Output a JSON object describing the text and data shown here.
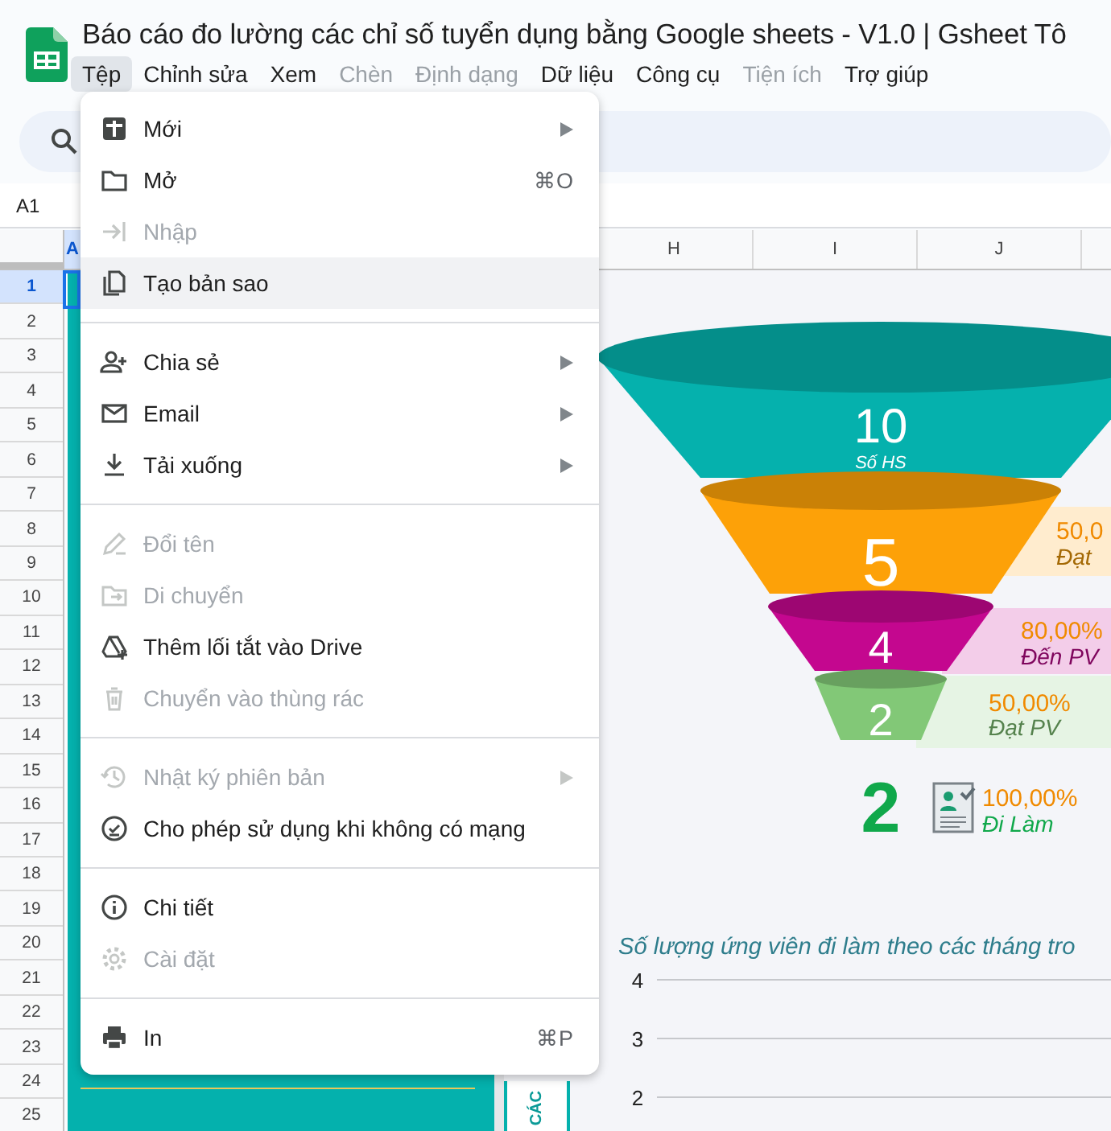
{
  "app": {
    "title": "Báo cáo đo lường các chỉ số tuyển dụng bằng Google sheets - V1.0 | Gsheet Tô"
  },
  "menubar": [
    {
      "label": "Tệp",
      "selected": true,
      "disabled": false
    },
    {
      "label": "Chỉnh sửa",
      "selected": false,
      "disabled": false
    },
    {
      "label": "Xem",
      "selected": false,
      "disabled": false
    },
    {
      "label": "Chèn",
      "selected": false,
      "disabled": true
    },
    {
      "label": "Định dạng",
      "selected": false,
      "disabled": true
    },
    {
      "label": "Dữ liệu",
      "selected": false,
      "disabled": false
    },
    {
      "label": "Công cụ",
      "selected": false,
      "disabled": false
    },
    {
      "label": "Tiện ích",
      "selected": false,
      "disabled": true
    },
    {
      "label": "Trợ giúp",
      "selected": false,
      "disabled": false
    }
  ],
  "name_box": "A1",
  "column_headers": [
    {
      "label": "A",
      "selected": true
    },
    {
      "label": "H",
      "selected": false
    },
    {
      "label": "I",
      "selected": false
    },
    {
      "label": "J",
      "selected": false
    }
  ],
  "row_headers": [
    {
      "label": "1",
      "selected": true
    },
    {
      "label": "2",
      "selected": false
    },
    {
      "label": "3",
      "selected": false
    },
    {
      "label": "4",
      "selected": false
    },
    {
      "label": "5",
      "selected": false
    },
    {
      "label": "6",
      "selected": false
    },
    {
      "label": "7",
      "selected": false
    },
    {
      "label": "8",
      "selected": false
    },
    {
      "label": "9",
      "selected": false
    },
    {
      "label": "10",
      "selected": false
    },
    {
      "label": "11",
      "selected": false
    },
    {
      "label": "12",
      "selected": false
    },
    {
      "label": "13",
      "selected": false
    },
    {
      "label": "14",
      "selected": false
    },
    {
      "label": "15",
      "selected": false
    },
    {
      "label": "16",
      "selected": false
    },
    {
      "label": "17",
      "selected": false
    },
    {
      "label": "18",
      "selected": false
    },
    {
      "label": "19",
      "selected": false
    },
    {
      "label": "20",
      "selected": false
    },
    {
      "label": "21",
      "selected": false
    },
    {
      "label": "22",
      "selected": false
    },
    {
      "label": "23",
      "selected": false
    },
    {
      "label": "24",
      "selected": false
    },
    {
      "label": "25",
      "selected": false
    }
  ],
  "file_menu": {
    "items": [
      {
        "kind": "item",
        "label": "Mới",
        "submenu": true,
        "disabled": false,
        "selected": false
      },
      {
        "kind": "item",
        "label": "Mở",
        "shortcut": "⌘O",
        "submenu": false,
        "disabled": false,
        "selected": false
      },
      {
        "kind": "item",
        "label": "Nhập",
        "submenu": false,
        "disabled": true,
        "selected": false
      },
      {
        "kind": "item",
        "label": "Tạo bản sao",
        "submenu": false,
        "disabled": false,
        "selected": true
      },
      {
        "kind": "divider"
      },
      {
        "kind": "item",
        "label": "Chia sẻ",
        "submenu": true,
        "disabled": false,
        "selected": false
      },
      {
        "kind": "item",
        "label": "Email",
        "submenu": true,
        "disabled": false,
        "selected": false
      },
      {
        "kind": "item",
        "label": "Tải xuống",
        "submenu": true,
        "disabled": false,
        "selected": false
      },
      {
        "kind": "divider"
      },
      {
        "kind": "item",
        "label": "Đổi tên",
        "submenu": false,
        "disabled": true,
        "selected": false
      },
      {
        "kind": "item",
        "label": "Di chuyển",
        "submenu": false,
        "disabled": true,
        "selected": false
      },
      {
        "kind": "item",
        "label": "Thêm lối tắt vào Drive",
        "submenu": false,
        "disabled": false,
        "selected": false
      },
      {
        "kind": "item",
        "label": "Chuyển vào thùng rác",
        "submenu": false,
        "disabled": true,
        "selected": false
      },
      {
        "kind": "divider"
      },
      {
        "kind": "item",
        "label": "Nhật ký phiên bản",
        "submenu": true,
        "disabled": true,
        "selected": false
      },
      {
        "kind": "item",
        "label": "Cho phép sử dụng khi không có mạng",
        "submenu": false,
        "disabled": false,
        "selected": false
      },
      {
        "kind": "divider"
      },
      {
        "kind": "item",
        "label": "Chi tiết",
        "submenu": false,
        "disabled": false,
        "selected": false
      },
      {
        "kind": "item",
        "label": "Cài đặt",
        "submenu": false,
        "disabled": true,
        "selected": false
      },
      {
        "kind": "divider"
      },
      {
        "kind": "item",
        "label": "In",
        "shortcut": "⌘P",
        "submenu": false,
        "disabled": false,
        "selected": false
      }
    ]
  },
  "dashboard": {
    "side_heading": "CÁC",
    "funnel": [
      {
        "value": "10",
        "caption": "Số HS",
        "color": "#05b1ad"
      },
      {
        "value": "5",
        "percent": "50,0",
        "caption": "Đạt",
        "color": "#fda108"
      },
      {
        "value": "4",
        "percent": "80,00%",
        "caption": "Đến PV",
        "color": "#c4078f"
      },
      {
        "value": "2",
        "percent": "50,00%",
        "caption": "Đạt PV",
        "color": "#82c877"
      }
    ],
    "result": {
      "value": "2",
      "percent": "100,00%",
      "caption": "Đi Làm"
    },
    "chart": {
      "title": "Số lượng ứng viên đi làm theo các tháng tro",
      "yticks": [
        "4",
        "3",
        "2"
      ]
    }
  }
}
